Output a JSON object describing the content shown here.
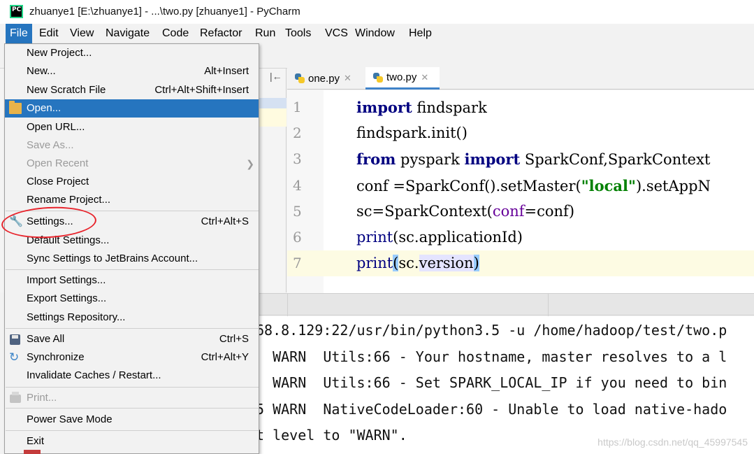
{
  "window": {
    "title": "zhuanye1 [E:\\zhuanye1] - ...\\two.py [zhuanye1] - PyCharm",
    "app_icon_text": "PC"
  },
  "menubar": [
    "File",
    "Edit",
    "View",
    "Navigate",
    "Code",
    "Refactor",
    "Run",
    "Tools",
    "VCS",
    "Window",
    "Help"
  ],
  "editor": {
    "tabs": [
      {
        "label": "one.py",
        "active": false
      },
      {
        "label": "two.py",
        "active": true
      }
    ],
    "line_numbers": [
      "1",
      "2",
      "3",
      "4",
      "5",
      "6",
      "7"
    ],
    "code": {
      "l1_kw": "import",
      "l1_rest": " findspark",
      "l2": "findspark.init()",
      "l3_kw1": "from",
      "l3_mid": " pyspark ",
      "l3_kw2": "import",
      "l3_rest": " SparkConf,SparkContext",
      "l4_a": "conf =SparkConf().setMaster(",
      "l4_str": "\"local\"",
      "l4_b": ").setAppN",
      "l5_a": "sc=SparkContext(",
      "l5_param": "conf",
      "l5_b": "=conf)",
      "l6_fn": "print",
      "l6_rest": "(sc.applicationId)",
      "l7_fn": "print",
      "l7_paren_open": "(",
      "l7_mid": "sc.",
      "l7_name": "version",
      "l7_paren_close": ")"
    }
  },
  "console": {
    "lines": [
      "68.8.129:22/usr/bin/python3.5 -u /home/hadoop/test/two.p",
      "  WARN  Utils:66 - Your hostname, master resolves to a l",
      "  WARN  Utils:66 - Set SPARK_LOCAL_IP if you need to bin",
      "5 WARN  NativeCodeLoader:60 - Unable to load native-hado",
      "t level to \"WARN\"."
    ],
    "watermark": "https://blog.csdn.net/qq_45997545"
  },
  "file_menu": {
    "items": [
      {
        "label": "New Project...",
        "shortcut": ""
      },
      {
        "label": "New...",
        "shortcut": "Alt+Insert"
      },
      {
        "label": "New Scratch File",
        "shortcut": "Ctrl+Alt+Shift+Insert"
      },
      {
        "label": "Open...",
        "shortcut": ""
      },
      {
        "label": "Open URL...",
        "shortcut": ""
      },
      {
        "label": "Save As...",
        "shortcut": ""
      },
      {
        "label": "Open Recent",
        "shortcut": ""
      },
      {
        "label": "Close Project",
        "shortcut": ""
      },
      {
        "label": "Rename Project...",
        "shortcut": ""
      },
      {
        "label": "Settings...",
        "shortcut": "Ctrl+Alt+S"
      },
      {
        "label": "Default Settings...",
        "shortcut": ""
      },
      {
        "label": "Sync Settings to JetBrains Account...",
        "shortcut": ""
      },
      {
        "label": "Import Settings...",
        "shortcut": ""
      },
      {
        "label": "Export Settings...",
        "shortcut": ""
      },
      {
        "label": "Settings Repository...",
        "shortcut": ""
      },
      {
        "label": "Save All",
        "shortcut": "Ctrl+S"
      },
      {
        "label": "Synchronize",
        "shortcut": "Ctrl+Alt+Y"
      },
      {
        "label": "Invalidate Caches / Restart...",
        "shortcut": ""
      },
      {
        "label": "Print...",
        "shortcut": ""
      },
      {
        "label": "Power Save Mode",
        "shortcut": ""
      },
      {
        "label": "Exit",
        "shortcut": ""
      }
    ]
  },
  "colors": {
    "selection": "#2675bf",
    "annotation": "#e8242c",
    "keyword": "#000080",
    "string": "#008000"
  }
}
